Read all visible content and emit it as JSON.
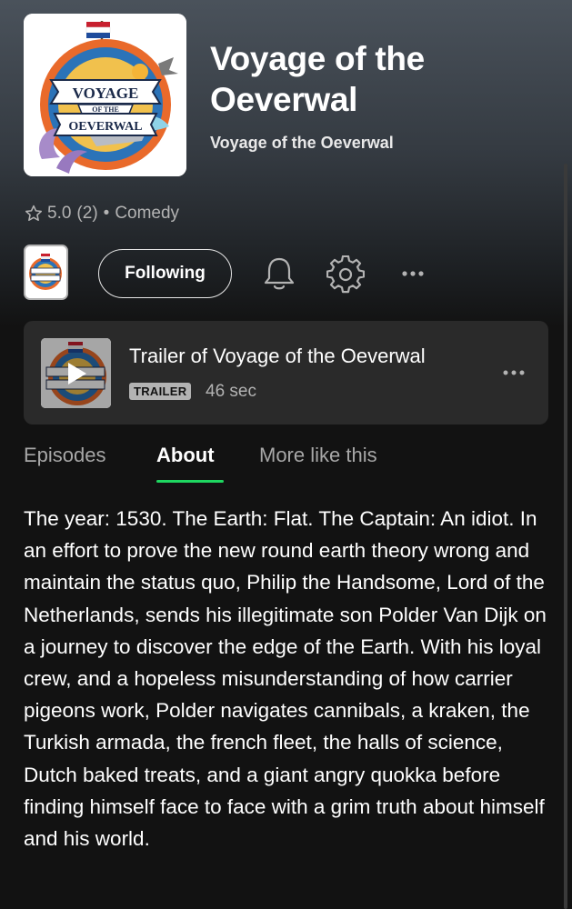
{
  "podcast": {
    "title": "Voyage of the Oeverwal",
    "publisher": "Voyage of the Oeverwal",
    "rating": "5.0",
    "rating_count": "(2)",
    "separator": "•",
    "category": "Comedy",
    "cover_logo_line1": "VOYAGE",
    "cover_logo_line2": "OF THE",
    "cover_logo_line3": "OEVERWAL"
  },
  "actions": {
    "follow_label": "Following",
    "bell_icon": "bell-icon",
    "settings_icon": "gear-icon",
    "more_icon": "more-horizontal-icon"
  },
  "trailer": {
    "title": "Trailer of Voyage of the Oeverwal",
    "badge": "TRAILER",
    "duration": "46 sec"
  },
  "tabs": [
    {
      "label": "Episodes",
      "active": false
    },
    {
      "label": "About",
      "active": true
    },
    {
      "label": "More like this",
      "active": false
    }
  ],
  "about": {
    "description": "The year: 1530. The Earth: Flat. The Captain: An idiot. In an effort to prove the new round earth theory wrong and maintain the status quo, Philip the Handsome, Lord of the Netherlands, sends his illegitimate son Polder Van Dijk on a journey to discover the edge of the Earth. With his loyal crew, and a hopeless misunderstanding of how carrier pigeons work, Polder navigates cannibals, a kraken, the Turkish armada, the french fleet, the halls of science, Dutch baked treats, and a giant angry quokka before finding himself face to face with a grim truth about himself and his world."
  },
  "colors": {
    "background": "#121212",
    "accent": "#1ed760",
    "secondary_text": "#b3b3b3",
    "card": "#2a2a2a"
  }
}
